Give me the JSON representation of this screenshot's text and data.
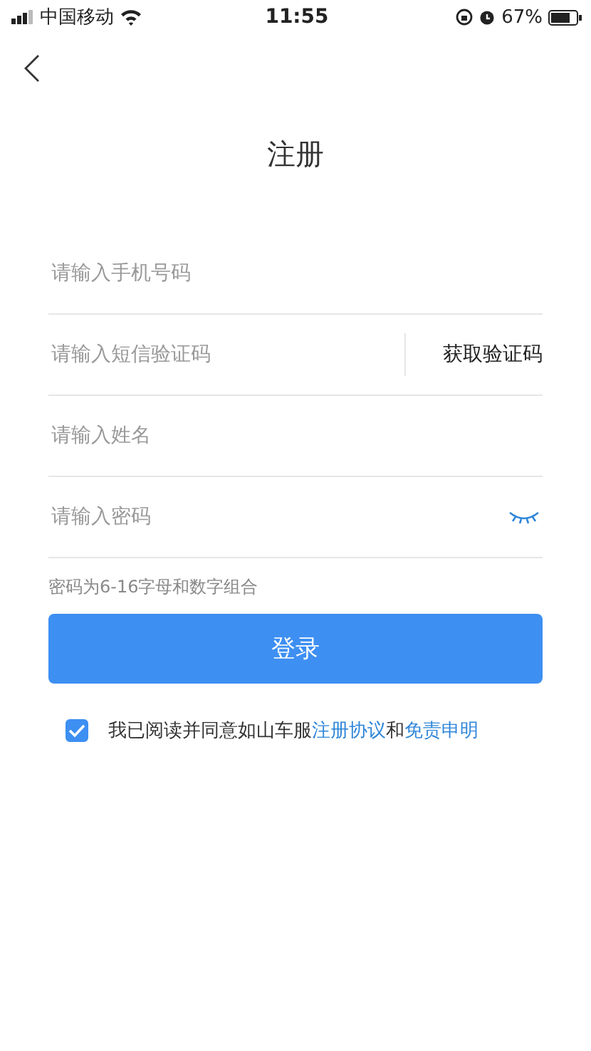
{
  "status_bar": {
    "carrier": "中国移动",
    "time": "11:55",
    "battery": "67%"
  },
  "title": "注册",
  "fields": [
    {
      "kind": "text",
      "placeholder": "请输入手机号码"
    },
    {
      "kind": "code",
      "placeholder": "请输入短信验证码",
      "action": "获取验证码"
    },
    {
      "kind": "text",
      "placeholder": "请输入姓名"
    },
    {
      "kind": "password",
      "placeholder": "请输入密码",
      "password_visible": false
    }
  ],
  "hint": "密码为6-16字母和数字组合",
  "submit": "登录",
  "agreement": {
    "checked": true,
    "parts": [
      {
        "kind": "text",
        "text": "我已阅读并同意如山车服"
      },
      {
        "kind": "link",
        "text": "注册协议"
      },
      {
        "kind": "text",
        "text": "和"
      },
      {
        "kind": "link",
        "text": "免责申明"
      }
    ]
  }
}
